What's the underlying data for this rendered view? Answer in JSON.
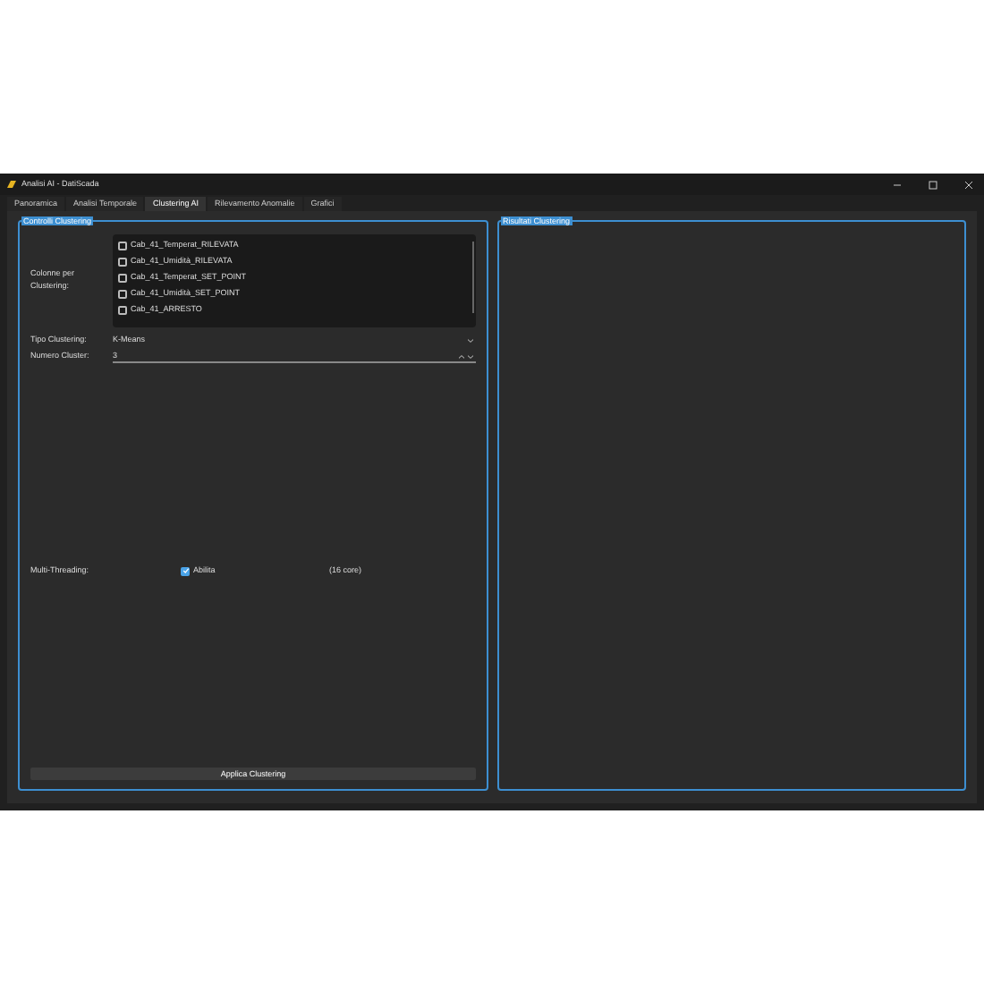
{
  "window": {
    "title": "Analisi AI - DatiScada"
  },
  "tabs": [
    {
      "label": "Panoramica",
      "selected": false
    },
    {
      "label": "Analisi Temporale",
      "selected": false
    },
    {
      "label": "Clustering AI",
      "selected": true
    },
    {
      "label": "Rilevamento Anomalie",
      "selected": false
    },
    {
      "label": "Grafici",
      "selected": false
    }
  ],
  "controls_panel": {
    "title": "Controlli Clustering",
    "columns_label": "Colonne per Clustering:",
    "columns": [
      {
        "label": "Cab_41_Temperat_RILEVATA",
        "checked": false
      },
      {
        "label": "Cab_41_Umidità_RILEVATA",
        "checked": false
      },
      {
        "label": "Cab_41_Temperat_SET_POINT",
        "checked": false
      },
      {
        "label": "Cab_41_Umidità_SET_POINT",
        "checked": false
      },
      {
        "label": "Cab_41_ARRESTO",
        "checked": false
      }
    ],
    "type_label": "Tipo Clustering:",
    "type_value": "K-Means",
    "count_label": "Numero Cluster:",
    "count_value": "3",
    "threading_label": "Multi-Threading:",
    "threading_option": {
      "label": "Abilita",
      "checked": true
    },
    "cores": "(16 core)",
    "apply_button": "Applica Clustering"
  },
  "results_panel": {
    "title": "Risultati Clustering"
  }
}
